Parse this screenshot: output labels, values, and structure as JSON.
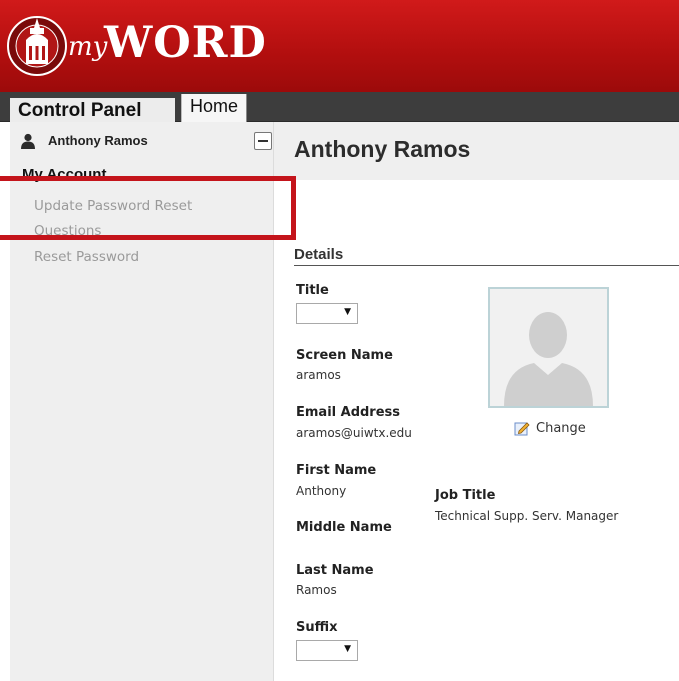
{
  "header": {
    "logo_prefix": "my",
    "logo_word": "WORD",
    "brand_color": "#c0111c"
  },
  "nav": {
    "control_panel": "Control Panel",
    "home": "Home"
  },
  "sidebar": {
    "user_name": "Anthony Ramos",
    "section_title": "My Account",
    "items": [
      {
        "label": "Update Password Reset"
      },
      {
        "label": "Questions"
      },
      {
        "label": "Reset Password"
      }
    ]
  },
  "main": {
    "title": "Anthony Ramos",
    "details_heading": "Details",
    "fields": {
      "title_label": "Title",
      "screen_name_label": "Screen Name",
      "screen_name_value": "aramos",
      "email_label": "Email Address",
      "email_value": "aramos@uiwtx.edu",
      "first_name_label": "First Name",
      "first_name_value": "Anthony",
      "middle_name_label": "Middle Name",
      "last_name_label": "Last Name",
      "last_name_value": "Ramos",
      "suffix_label": "Suffix",
      "job_title_label": "Job Title",
      "job_title_value": "Technical Supp. Serv. Manager"
    },
    "photo": {
      "change_label": "Change"
    }
  },
  "icons": {
    "user": "user-icon",
    "collapse": "minus-icon",
    "dropdown": "triangle-down",
    "edit": "pencil-icon"
  },
  "colors": {
    "nav_bar": "#3d3d3d",
    "highlight": "#c4141b",
    "sidebar_bg": "#efefef"
  }
}
